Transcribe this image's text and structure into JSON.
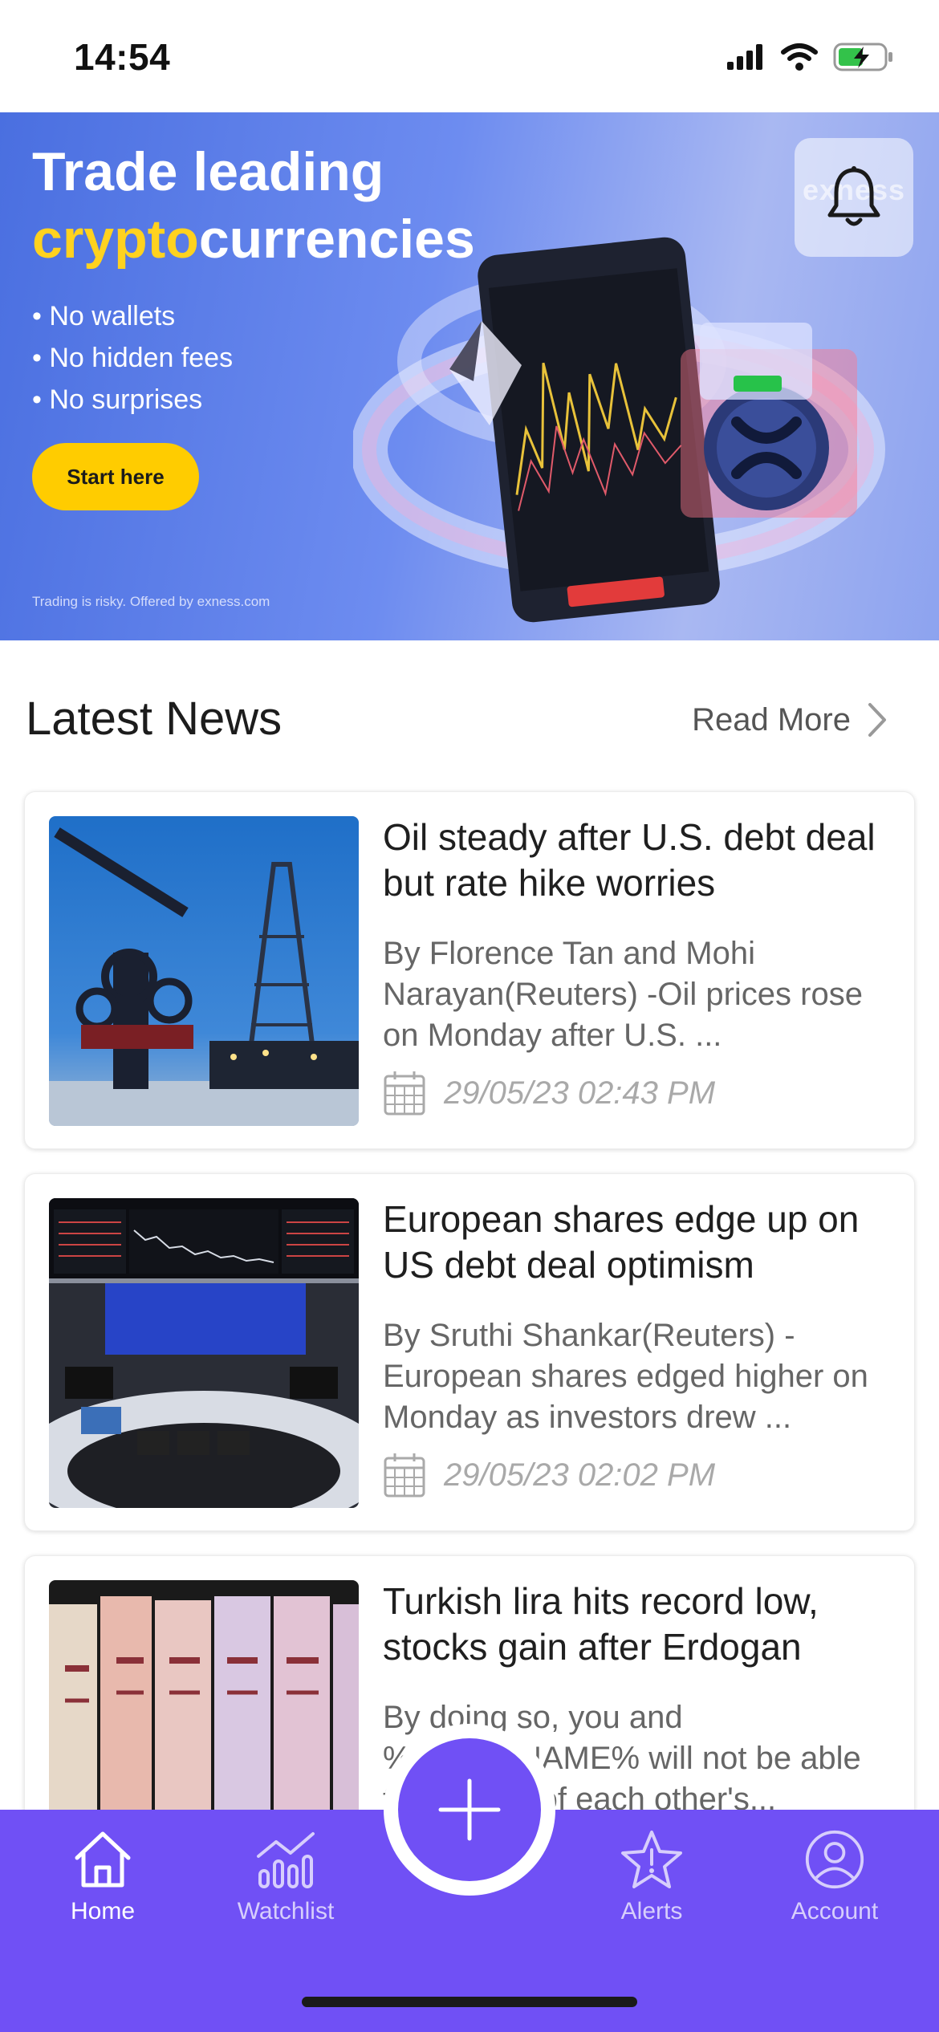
{
  "status_bar": {
    "time": "14:54",
    "icons": [
      "cellular-signal-icon",
      "wifi-icon",
      "battery-charging-icon"
    ],
    "battery_color": "#33c24a"
  },
  "banner": {
    "title_line1": "Trade leading",
    "title_highlight": "crypto",
    "title_rest": "currencies",
    "bullets": [
      "• No wallets",
      "• No hidden fees",
      "• No surprises"
    ],
    "cta_label": "Start here",
    "disclaimer": "Trading is risky. Offered by exness.com",
    "watermark": "exness",
    "accent_color": "#ffd21f",
    "notification_icon": "bell-icon"
  },
  "news_section": {
    "title": "Latest News",
    "read_more_label": "Read More"
  },
  "news": [
    {
      "title": "Oil steady after U.S. debt deal but rate hike worries",
      "description": "By Florence Tan and Mohi Narayan(Reuters) -Oil prices rose on Monday after U.S. ...",
      "date": "29/05/23 02:43 PM",
      "thumbnail": "oil-rig-photo"
    },
    {
      "title": "European shares edge up on US debt deal optimism",
      "description": "By Sruthi Shankar(Reuters) - European shares edged higher on Monday as investors drew ...",
      "date": "29/05/23 02:02 PM",
      "thumbnail": "trading-floor-photo"
    },
    {
      "title": "Turkish lira hits record low, stocks gain after Erdogan",
      "description": "By doing so, you and %USER_NAME% will not be able to see any of each other's...",
      "date": "",
      "thumbnail": "lira-banknotes-photo"
    }
  ],
  "tabbar": {
    "tabs": [
      {
        "label": "Home",
        "icon": "home-icon",
        "active": true
      },
      {
        "label": "Watchlist",
        "icon": "watchlist-chart-icon",
        "active": false
      },
      {
        "label": "Alerts",
        "icon": "star-alert-icon",
        "active": false
      },
      {
        "label": "Account",
        "icon": "user-icon",
        "active": false
      }
    ],
    "fab_icon": "plus-icon",
    "bar_color": "#7050f5"
  }
}
